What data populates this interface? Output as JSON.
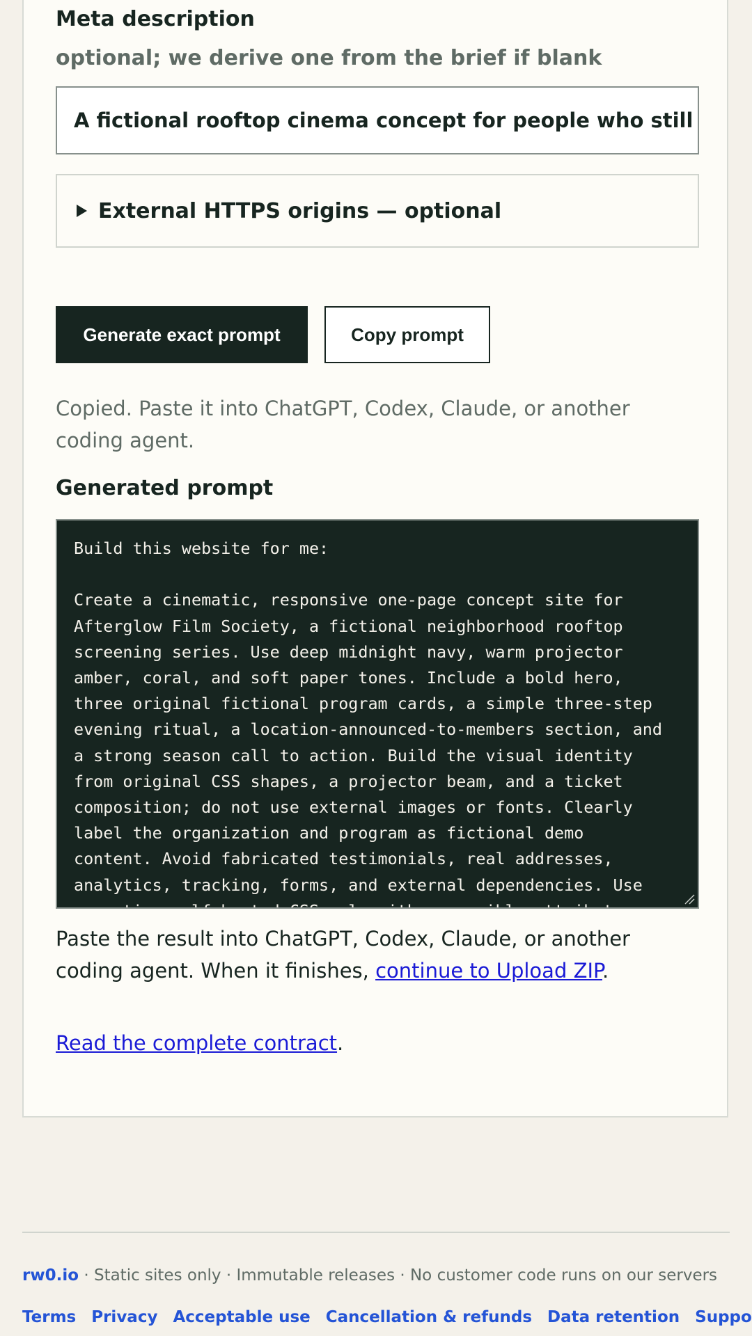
{
  "meta": {
    "label": "Meta description",
    "hint": "optional; we derive one from the brief if blank",
    "value": "A fictional rooftop cinema concept for people who still beli"
  },
  "details": {
    "label": "External HTTPS origins — optional"
  },
  "actions": {
    "generate_label": "Generate exact prompt",
    "copy_label": "Copy prompt"
  },
  "status": {
    "text": "Copied. Paste it into ChatGPT, Codex, Claude, or another coding agent."
  },
  "generated": {
    "label": "Generated prompt",
    "text": "Build this website for me:\n\nCreate a cinematic, responsive one-page concept site for\nAfterglow Film Society, a fictional neighborhood rooftop\nscreening series. Use deep midnight navy, warm projector\namber, coral, and soft paper tones. Include a bold hero,\nthree original fictional program cards, a simple three-step\nevening ritual, a location-announced-to-members section, and\na strong season call to action. Build the visual identity\nfrom original CSS shapes, a projector beam, and a ticket\ncomposition; do not use external images or fonts. Clearly\nlabel the organization and program as fictional demo\ncontent. Avoid fabricated testimonials, real addresses,\nanalytics, tracking, forms, and external dependencies. Use\nsemantic, self-hosted CSS only with accessible attributes."
  },
  "after": {
    "before_link": "Paste the result into ChatGPT, Codex, Claude, or another coding agent. When it finishes, ",
    "link": "continue to Upload ZIP",
    "after_link": "."
  },
  "contract": {
    "link": "Read the complete contract",
    "after_link": "."
  },
  "footer": {
    "brand": "rw0.io",
    "tagline": " · Static sites only · Immutable releases · No customer code runs on our servers",
    "links": [
      "Terms",
      "Privacy",
      "Acceptable use",
      "Cancellation & refunds",
      "Data retention",
      "Support"
    ]
  }
}
